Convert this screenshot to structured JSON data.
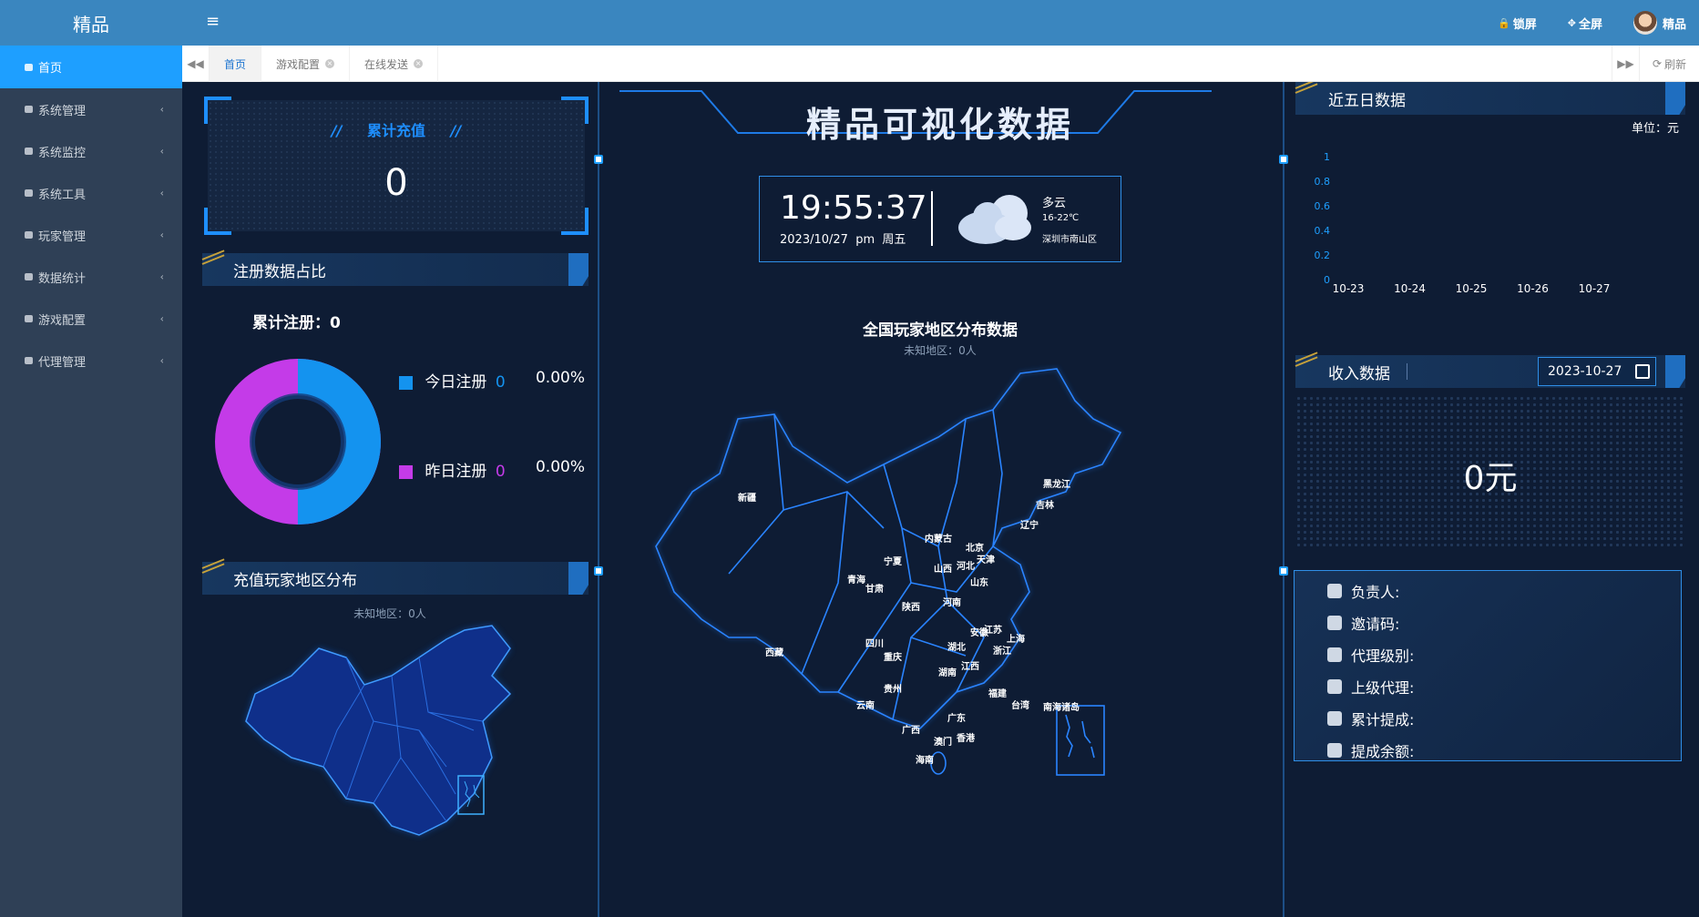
{
  "app": {
    "brand": "精品"
  },
  "sidebar": {
    "items": [
      {
        "label": "首页",
        "active": true
      },
      {
        "label": "系统管理",
        "arrow": "‹"
      },
      {
        "label": "系统监控",
        "arrow": "‹"
      },
      {
        "label": "系统工具",
        "arrow": "‹"
      },
      {
        "label": "玩家管理",
        "arrow": "‹"
      },
      {
        "label": "数据统计",
        "arrow": "‹"
      },
      {
        "label": "游戏配置",
        "arrow": "‹"
      },
      {
        "label": "代理管理",
        "arrow": "‹"
      }
    ]
  },
  "topbar": {
    "menu_icon": "≡",
    "lock_label": "锁屏",
    "fullscreen_label": "全屏",
    "user_name": "精品"
  },
  "tabbar": {
    "tabs": [
      {
        "label": "首页",
        "active": true
      },
      {
        "label": "游戏配置"
      },
      {
        "label": "在线发送"
      }
    ],
    "refresh_label": "刷新"
  },
  "left": {
    "recharge": {
      "title": "累计充值",
      "value": "0",
      "slash_left": "//",
      "slash_right": "//"
    },
    "register": {
      "title": "注册数据占比",
      "total_label": "累计注册：0",
      "today_label": "今日注册",
      "today_value": "0",
      "today_percent": "0.00%",
      "yesterday_label": "昨日注册",
      "yesterday_value": "0",
      "yesterday_percent": "0.00%",
      "colors": {
        "today": "#1493ef",
        "yesterday": "#c43be8"
      }
    },
    "region": {
      "title": "充值玩家地区分布",
      "unknown": "未知地区：0人"
    }
  },
  "center": {
    "title": "精品可视化数据",
    "time": "19:55:37",
    "date": "2023/10/27  pm  周五",
    "weather": "多云",
    "temp": "16-22℃",
    "location": "深圳市南山区",
    "map_title": "全国玩家地区分布数据",
    "map_unknown": "未知地区：0人",
    "provinces": [
      "新疆",
      "西藏",
      "青海",
      "甘肃",
      "宁夏",
      "内蒙古",
      "黑龙江",
      "吉林",
      "辽宁",
      "北京",
      "天津",
      "河北",
      "山西",
      "山东",
      "河南",
      "陕西",
      "四川",
      "重庆",
      "湖北",
      "安徽",
      "江苏",
      "上海",
      "浙江",
      "湖南",
      "江西",
      "贵州",
      "云南",
      "广西",
      "广东",
      "福建",
      "台湾",
      "南海诸岛",
      "澳门",
      "香港",
      "海南"
    ]
  },
  "right": {
    "five_day": {
      "title": "近五日数据",
      "unit": "单位：元"
    },
    "income": {
      "title": "收入数据",
      "date": "2023-10-27",
      "value": "0元"
    },
    "agent": {
      "rows": [
        "负责人:",
        "邀请码:",
        "代理级别:",
        "上级代理:",
        "累计提成:",
        "提成余额:"
      ]
    }
  },
  "chart_data": {
    "type": "line",
    "categories": [
      "10-23",
      "10-24",
      "10-25",
      "10-26",
      "10-27"
    ],
    "values": [
      0,
      0,
      0,
      0,
      0
    ],
    "yticks": [
      "1",
      "0.8",
      "0.6",
      "0.4",
      "0.2",
      "0"
    ],
    "ylim": [
      0,
      1
    ],
    "ylabel": "单位：元"
  }
}
